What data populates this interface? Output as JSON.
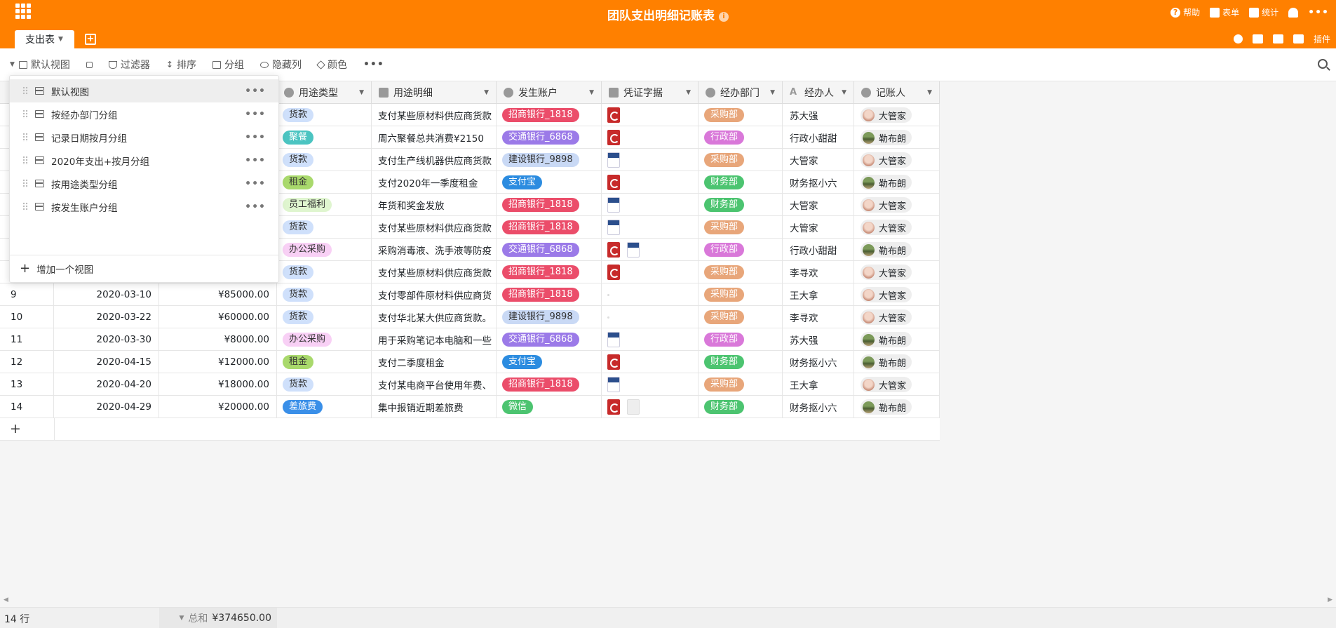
{
  "app": {
    "title": "团队支出明细记账表",
    "info_icon": "info-icon",
    "actions": [
      {
        "label": "帮助",
        "icon": "help-icon"
      },
      {
        "label": "表单",
        "icon": "form-icon"
      },
      {
        "label": "统计",
        "icon": "stats-icon"
      }
    ],
    "accent_color": "#ff8000"
  },
  "tabs": {
    "active_label": "支出表",
    "tools": {
      "plugin_label": "插件"
    }
  },
  "toolbar": {
    "view_label": "默认视图",
    "filter_label": "过滤器",
    "sort_label": "排序",
    "group_label": "分组",
    "hide_label": "隐藏列",
    "color_label": "颜色"
  },
  "columns": {
    "type": "用途类型",
    "detail": "用途明细",
    "account": "发生账户",
    "voucher": "凭证字据",
    "dept": "经办部门",
    "handler": "经办人",
    "recorder": "记账人"
  },
  "rows": [
    {
      "idx": "",
      "date": "",
      "amount": "",
      "type": "货款",
      "detail": "支付某些原材料供应商货款",
      "account": "招商银行_1818",
      "voucher": [
        "pdf"
      ],
      "dept": "采购部",
      "handler": "苏大强",
      "recorder": "大管家"
    },
    {
      "idx": "",
      "date": "",
      "amount": "",
      "type": "聚餐",
      "detail": "周六聚餐总共消费¥2150",
      "account": "交通银行_6868",
      "voucher": [
        "pdf"
      ],
      "dept": "行政部",
      "handler": "行政小甜甜",
      "recorder": "勒布朗"
    },
    {
      "idx": "",
      "date": "",
      "amount": "",
      "type": "货款",
      "detail": "支付生产线机器供应商货款",
      "account": "建设银行_9898",
      "voucher": [
        "doc"
      ],
      "dept": "采购部",
      "handler": "大管家",
      "recorder": "大管家"
    },
    {
      "idx": "",
      "date": "",
      "amount": "",
      "type": "租金",
      "detail": "支付2020年一季度租金",
      "account": "支付宝",
      "voucher": [
        "pdf"
      ],
      "dept": "财务部",
      "handler": "财务抠小六",
      "recorder": "勒布朗"
    },
    {
      "idx": "",
      "date": "",
      "amount": "",
      "type": "员工福利",
      "detail": "年货和奖金发放",
      "account": "招商银行_1818",
      "voucher": [
        "doc"
      ],
      "dept": "财务部",
      "handler": "大管家",
      "recorder": "大管家"
    },
    {
      "idx": "",
      "date": "",
      "amount": "",
      "type": "货款",
      "detail": "支付某些原材料供应商货款",
      "account": "招商银行_1818",
      "voucher": [
        "doc"
      ],
      "dept": "采购部",
      "handler": "大管家",
      "recorder": "大管家"
    },
    {
      "idx": "",
      "date": "",
      "amount": "",
      "type": "办公采购",
      "detail": "采购消毒液、洗手液等防疫",
      "account": "交通银行_6868",
      "voucher": [
        "pdf",
        "doc"
      ],
      "dept": "行政部",
      "handler": "行政小甜甜",
      "recorder": "勒布朗"
    },
    {
      "idx": "",
      "date": "",
      "amount": "",
      "type": "货款",
      "detail": "支付某些原材料供应商货款",
      "account": "招商银行_1818",
      "voucher": [
        "pdf"
      ],
      "dept": "采购部",
      "handler": "李寻欢",
      "recorder": "大管家"
    },
    {
      "idx": "9",
      "date": "2020-03-10",
      "amount": "¥85000.00",
      "type": "货款",
      "detail": "支付零部件原材料供应商货",
      "account": "招商银行_1818",
      "voucher": [
        "dot"
      ],
      "dept": "采购部",
      "handler": "王大拿",
      "recorder": "大管家"
    },
    {
      "idx": "10",
      "date": "2020-03-22",
      "amount": "¥60000.00",
      "type": "货款",
      "detail": "支付华北某大供应商货款。",
      "account": "建设银行_9898",
      "voucher": [
        "dot"
      ],
      "dept": "采购部",
      "handler": "李寻欢",
      "recorder": "大管家"
    },
    {
      "idx": "11",
      "date": "2020-03-30",
      "amount": "¥8000.00",
      "type": "办公采购",
      "detail": "用于采购笔记本电脑和一些",
      "account": "交通银行_6868",
      "voucher": [
        "doc"
      ],
      "dept": "行政部",
      "handler": "苏大强",
      "recorder": "勒布朗"
    },
    {
      "idx": "12",
      "date": "2020-04-15",
      "amount": "¥12000.00",
      "type": "租金",
      "detail": "支付二季度租金",
      "account": "支付宝",
      "voucher": [
        "pdf"
      ],
      "dept": "财务部",
      "handler": "财务抠小六",
      "recorder": "勒布朗"
    },
    {
      "idx": "13",
      "date": "2020-04-20",
      "amount": "¥18000.00",
      "type": "货款",
      "detail": "支付某电商平台使用年费、",
      "account": "招商银行_1818",
      "voucher": [
        "doc"
      ],
      "dept": "采购部",
      "handler": "王大拿",
      "recorder": "大管家"
    },
    {
      "idx": "14",
      "date": "2020-04-29",
      "amount": "¥20000.00",
      "type": "差旅费",
      "detail": "集中报销近期差旅费",
      "account": "微信",
      "voucher": [
        "pdf",
        "blank"
      ],
      "dept": "财务部",
      "handler": "财务抠小六",
      "recorder": "勒布朗"
    }
  ],
  "type_colors": {
    "货款": {
      "bg": "#cfe0fb",
      "fg": "#333333"
    },
    "聚餐": {
      "bg": "#4bc4c1",
      "fg": "#ffffff"
    },
    "租金": {
      "bg": "#a9d96c",
      "fg": "#333333"
    },
    "员工福利": {
      "bg": "#dff5cf",
      "fg": "#333333"
    },
    "办公采购": {
      "bg": "#f8d0f5",
      "fg": "#333333"
    },
    "差旅费": {
      "bg": "#3a8fe8",
      "fg": "#ffffff"
    }
  },
  "account_colors": {
    "招商银行_1818": {
      "bg": "#eb4d6a",
      "fg": "#ffffff"
    },
    "交通银行_6868": {
      "bg": "#9b7ae8",
      "fg": "#ffffff"
    },
    "建设银行_9898": {
      "bg": "#c9d9f5",
      "fg": "#333333"
    },
    "支付宝": {
      "bg": "#2c8ce0",
      "fg": "#ffffff"
    },
    "微信": {
      "bg": "#4cc470",
      "fg": "#ffffff"
    }
  },
  "dept_colors": {
    "采购部": {
      "bg": "#e8a67a",
      "fg": "#ffffff"
    },
    "行政部": {
      "bg": "#d978d9",
      "fg": "#ffffff"
    },
    "财务部": {
      "bg": "#4cc470",
      "fg": "#ffffff"
    }
  },
  "recorder_avatars": {
    "大管家": "a",
    "勒布朗": "b"
  },
  "view_menu": {
    "items": [
      "默认视图",
      "按经办部门分组",
      "记录日期按月分组",
      "2020年支出+按月分组",
      "按用途类型分组",
      "按发生账户分组"
    ],
    "active_index": 0,
    "add_label": "增加一个视图"
  },
  "status": {
    "row_count": "14 行",
    "sum_label": "总和",
    "sum_value": "¥374650.00"
  }
}
